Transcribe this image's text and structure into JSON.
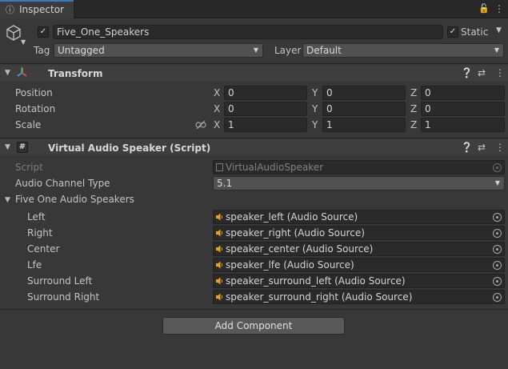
{
  "window": {
    "tab_label": "Inspector"
  },
  "object": {
    "active": true,
    "name": "Five_One_Speakers",
    "static_label": "Static",
    "static_checked": true,
    "tag_label": "Tag",
    "tag_value": "Untagged",
    "layer_label": "Layer",
    "layer_value": "Default"
  },
  "transform": {
    "title": "Transform",
    "rows": [
      {
        "label": "Position",
        "x": "0",
        "y": "0",
        "z": "0"
      },
      {
        "label": "Rotation",
        "x": "0",
        "y": "0",
        "z": "0"
      },
      {
        "label": "Scale",
        "x": "1",
        "y": "1",
        "z": "1"
      }
    ],
    "axis": {
      "x": "X",
      "y": "Y",
      "z": "Z"
    }
  },
  "script_component": {
    "title": "Virtual Audio Speaker (Script)",
    "script_label": "Script",
    "script_value": "VirtualAudioSpeaker",
    "channel_label": "Audio Channel Type",
    "channel_value": "5.1",
    "group_label": "Five One Audio Speakers",
    "speakers": [
      {
        "label": "Left",
        "value": "speaker_left (Audio Source)"
      },
      {
        "label": "Right",
        "value": "speaker_right (Audio Source)"
      },
      {
        "label": "Center",
        "value": "speaker_center (Audio Source)"
      },
      {
        "label": "Lfe",
        "value": "speaker_lfe (Audio Source)"
      },
      {
        "label": "Surround Left",
        "value": "speaker_surround_left (Audio Source)"
      },
      {
        "label": "Surround Right",
        "value": "speaker_surround_right (Audio Source)"
      }
    ]
  },
  "add_component_label": "Add Component",
  "colors": {
    "accent": "#3a79bb",
    "speaker_icon": "#e8a21a",
    "background": "#383838"
  }
}
